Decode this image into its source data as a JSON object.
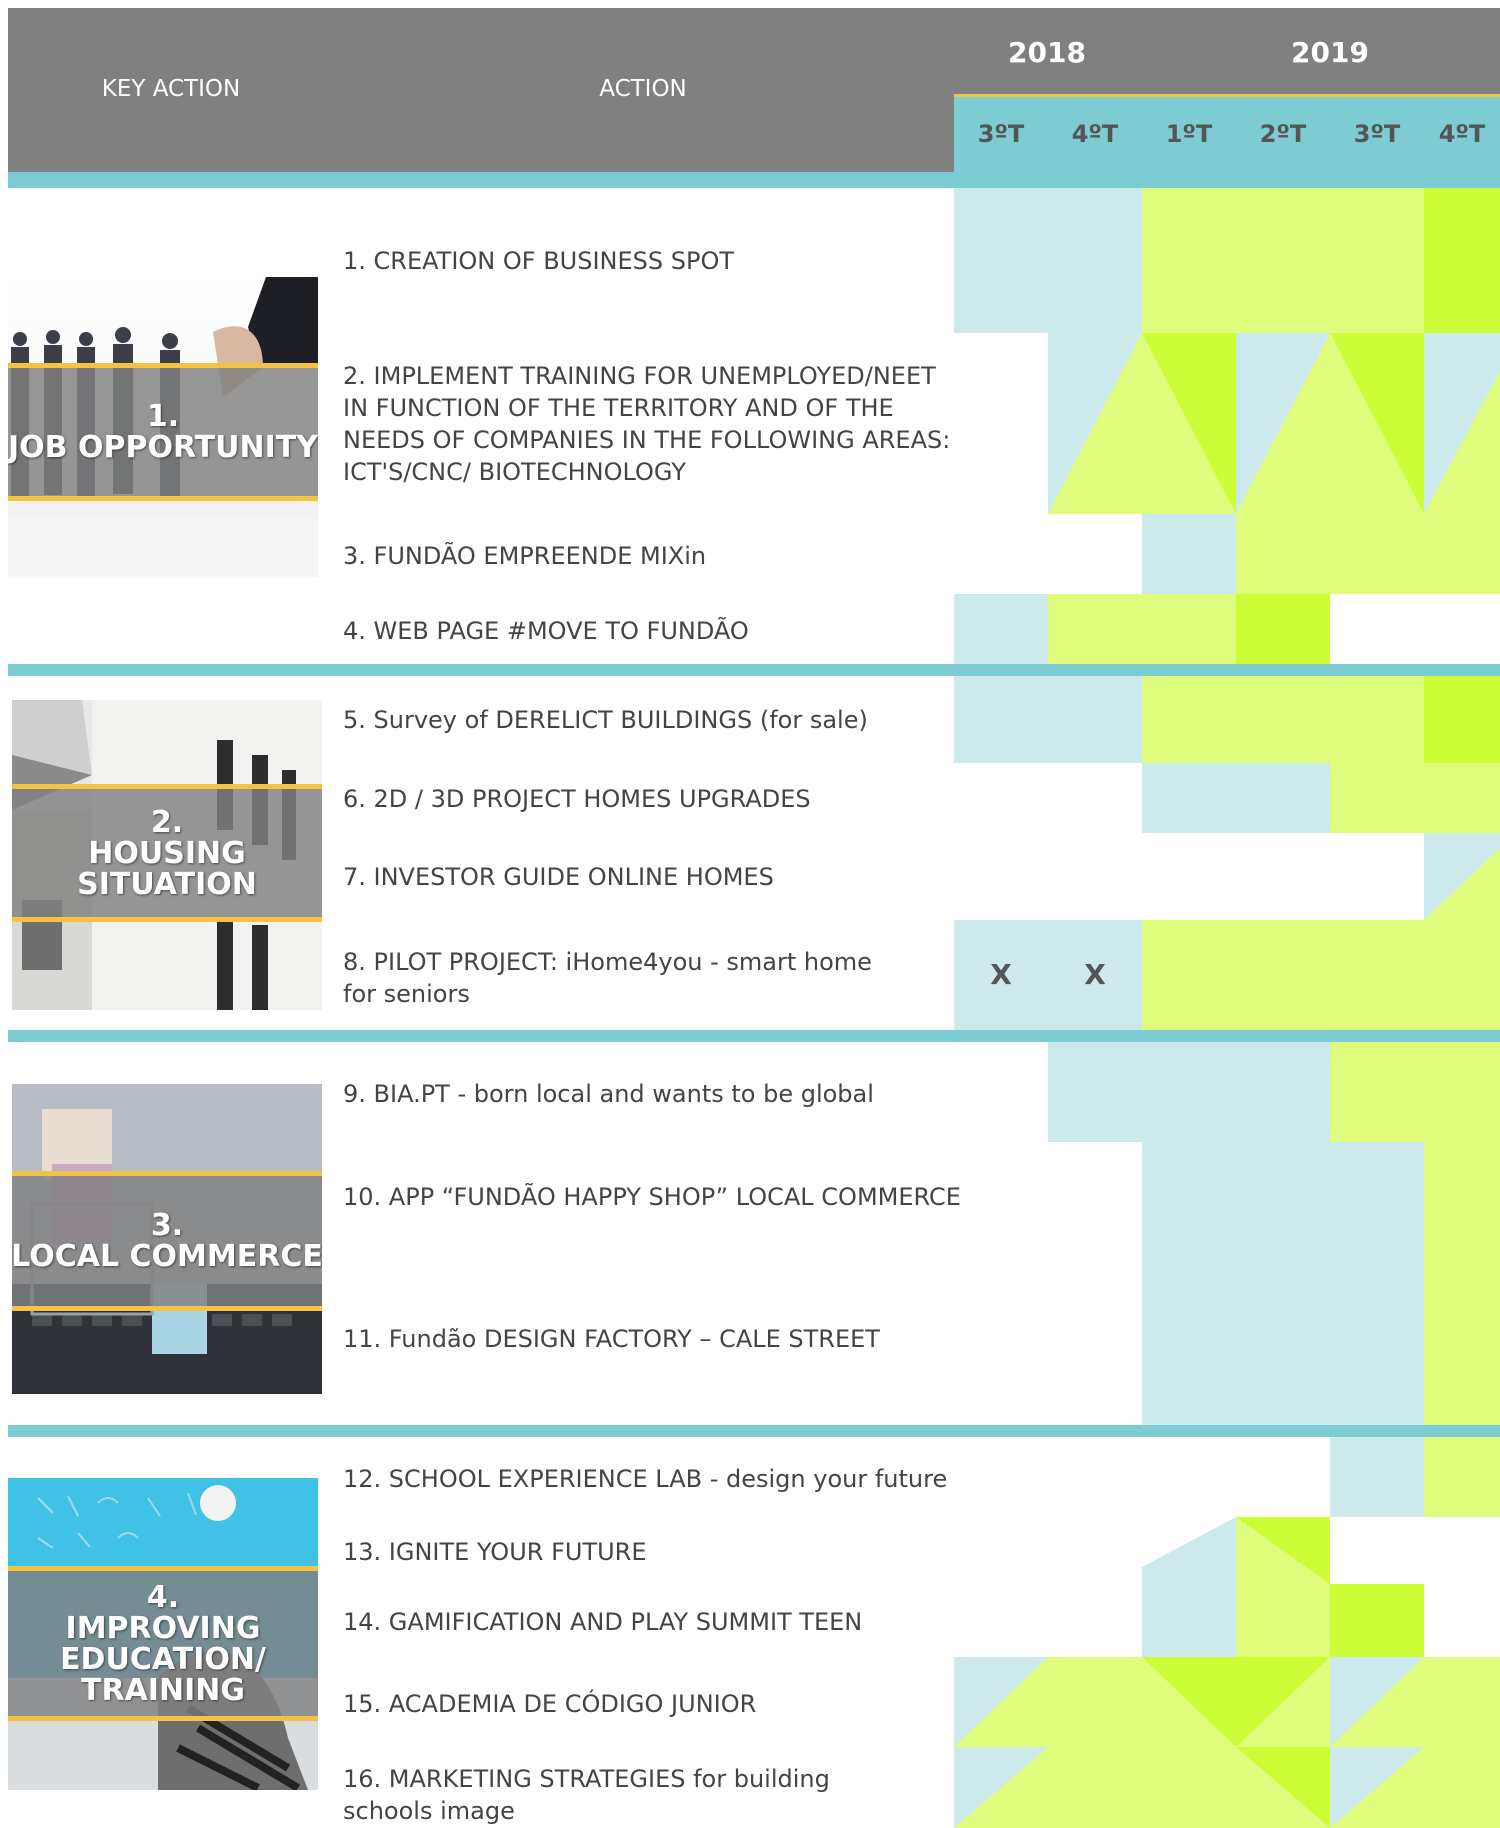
{
  "header": {
    "key_action_label": "KEY ACTION",
    "action_label": "ACTION",
    "years": [
      "2018",
      "2019"
    ],
    "quarters": [
      "3ºT",
      "4ºT",
      "1ºT",
      "2ºT",
      "3ºT",
      "4ºT"
    ]
  },
  "colors": {
    "header_gray": "#808080",
    "teal_bar": "#7dcbd3",
    "light_teal": "#cceaec",
    "light_green": "#e0fc7d",
    "bright_green": "#cdfd37",
    "gold": "#f5c242"
  },
  "key_actions": [
    {
      "number": "1.",
      "lines": [
        "JOB OPPORTUNITY"
      ],
      "image": "business-people-handshake"
    },
    {
      "number": "2.",
      "lines": [
        "HOUSING",
        "SITUATION"
      ],
      "image": "white-building-facade"
    },
    {
      "number": "3.",
      "lines": [
        "LOCAL COMMERCE"
      ],
      "image": "shopping-bags-keyboard"
    },
    {
      "number": "4.",
      "lines": [
        "IMPROVING",
        "EDUCATION/",
        "TRAINING"
      ],
      "image": "child-at-blackboard"
    }
  ],
  "actions": [
    {
      "text": "1. CREATION OF BUSINESS SPOT",
      "marks": [
        "",
        "",
        "",
        "",
        "",
        ""
      ]
    },
    {
      "text": "2. IMPLEMENT TRAINING FOR UNEMPLOYED/NEET IN FUNCTION OF THE TERRITORY AND OF THE NEEDS OF COMPANIES IN THE FOLLOWING AREAS: ICT'S/CNC/ BIOTECHNOLOGY",
      "marks": [
        "",
        "",
        "",
        "",
        "",
        ""
      ]
    },
    {
      "text": "3. FUNDÃO EMPREENDE MIXin",
      "marks": [
        "",
        "",
        "",
        "",
        "",
        ""
      ]
    },
    {
      "text": "4. WEB PAGE #MOVE TO FUNDÃO",
      "marks": [
        "",
        "",
        "",
        "",
        "",
        ""
      ]
    },
    {
      "text": "5. Survey of DERELICT BUILDINGS (for sale)",
      "marks": [
        "",
        "",
        "",
        "",
        "",
        ""
      ]
    },
    {
      "text": "6. 2D / 3D PROJECT HOMES UPGRADES",
      "marks": [
        "",
        "",
        "",
        "",
        "",
        ""
      ]
    },
    {
      "text": "7. INVESTOR GUIDE ONLINE HOMES",
      "marks": [
        "",
        "",
        "",
        "",
        "",
        ""
      ]
    },
    {
      "text": "8. PILOT PROJECT: iHome4you - smart home for seniors",
      "marks": [
        "X",
        "X",
        "",
        "",
        "",
        ""
      ]
    },
    {
      "text": "9. BIA.PT - born local and wants to be global",
      "marks": [
        "",
        "",
        "",
        "",
        "",
        ""
      ]
    },
    {
      "text": "10. APP “FUNDÃO HAPPY SHOP” LOCAL COMMERCE",
      "marks": [
        "",
        "",
        "",
        "",
        "",
        ""
      ]
    },
    {
      "text": "11. Fundão DESIGN FACTORY – CALE STREET",
      "marks": [
        "",
        "",
        "",
        "",
        "",
        ""
      ]
    },
    {
      "text": "12. SCHOOL EXPERIENCE LAB - design your future",
      "marks": [
        "",
        "",
        "",
        "",
        "",
        ""
      ]
    },
    {
      "text": "13. IGNITE YOUR FUTURE",
      "marks": [
        "",
        "",
        "",
        "",
        "",
        ""
      ]
    },
    {
      "text": "14. GAMIFICATION AND PLAY SUMMIT TEEN",
      "marks": [
        "",
        "",
        "",
        "",
        "",
        ""
      ]
    },
    {
      "text": "15. ACADEMIA DE CÓDIGO JUNIOR",
      "marks": [
        "",
        "",
        "",
        "",
        "",
        ""
      ]
    },
    {
      "text": "16. MARKETING STRATEGIES for building schools image",
      "marks": [
        "",
        "",
        "",
        "",
        "",
        ""
      ]
    }
  ]
}
